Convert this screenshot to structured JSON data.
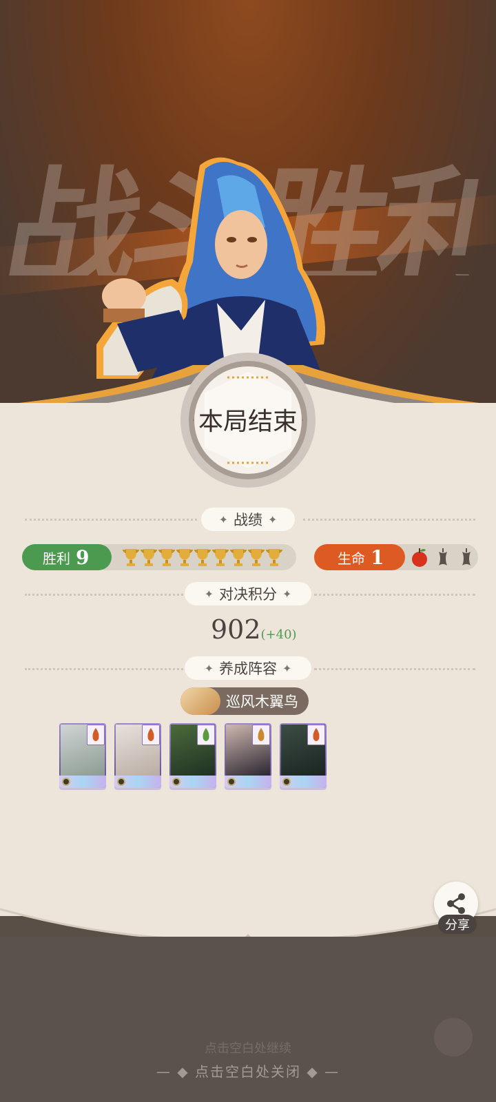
{
  "background": {
    "watermark": "战斗胜利"
  },
  "banner": {
    "title": "本局结束"
  },
  "sections": {
    "record": "战绩",
    "score": "对决积分",
    "lineup": "养成阵容"
  },
  "record": {
    "win_label": "胜利",
    "win_count": "9",
    "trophies": 9,
    "life_label": "生命",
    "life_count": "1",
    "apples_total": 3,
    "apples_remaining": 1
  },
  "score": {
    "value": "902",
    "delta": "(+40)"
  },
  "lineup": {
    "name": "巡风木翼鸟",
    "cards": [
      {
        "trait_icon": "flame-icon"
      },
      {
        "trait_icon": "flame-icon"
      },
      {
        "trait_icon": "leaf-icon"
      },
      {
        "trait_icon": "nest-icon"
      },
      {
        "trait_icon": "flame-icon"
      }
    ]
  },
  "share": {
    "label": "分享"
  },
  "footer": {
    "faint_text": "点击空白处继续",
    "close_hint": "点击空白处关闭"
  },
  "colors": {
    "win_green": "#4b9a4f",
    "life_orange": "#dd5a23",
    "panel": "#ede5da"
  }
}
